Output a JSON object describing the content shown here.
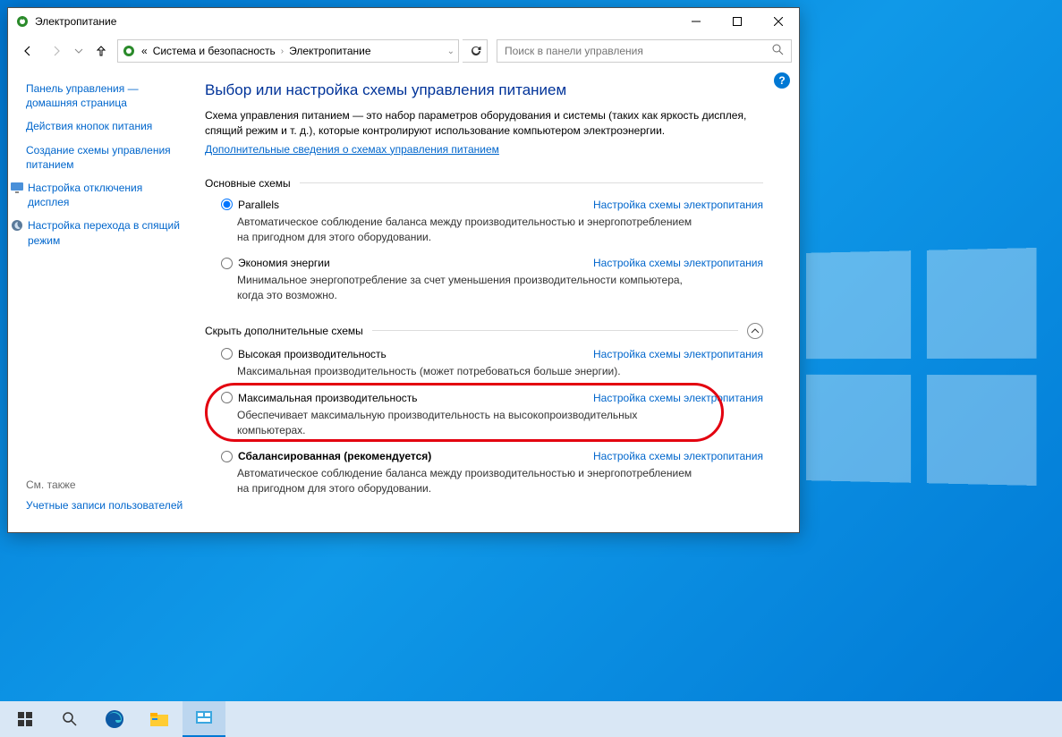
{
  "window": {
    "title": "Электропитание",
    "breadcrumb_prefix": "«",
    "breadcrumb1": "Система и безопасность",
    "breadcrumb2": "Электропитание",
    "search_placeholder": "Поиск в панели управления"
  },
  "sidebar": {
    "home": "Панель управления — домашняя страница",
    "links": [
      "Действия кнопок питания",
      "Создание схемы управления питанием",
      "Настройка отключения дисплея",
      "Настройка перехода в спящий режим"
    ],
    "see_also_h": "См. также",
    "see_also": "Учетные записи пользователей"
  },
  "main": {
    "heading": "Выбор или настройка схемы управления питанием",
    "desc": "Схема управления питанием — это набор параметров оборудования и системы (таких как яркость дисплея, спящий режим и т. д.), которые контролируют использование компьютером электроэнергии.",
    "more_link": "Дополнительные сведения о схемах управления питанием",
    "section1": "Основные схемы",
    "section2": "Скрыть дополнительные схемы",
    "change_link": "Настройка схемы электропитания",
    "plans": [
      {
        "name": "Parallels",
        "desc": "Автоматическое соблюдение баланса между производительностью и энергопотреблением на пригодном для этого оборудовании.",
        "checked": true
      },
      {
        "name": "Экономия энергии",
        "desc": "Минимальное энергопотребление за счет уменьшения производительности компьютера, когда это возможно.",
        "checked": false
      }
    ],
    "extra_plans": [
      {
        "name": "Высокая производительность",
        "desc": "Максимальная производительность (может потребоваться больше энергии).",
        "checked": false,
        "bold": false
      },
      {
        "name": "Максимальная производительность",
        "desc": "Обеспечивает максимальную производительность на высокопроизводительных компьютерах.",
        "checked": false,
        "bold": false,
        "highlight": true
      },
      {
        "name": "Сбалансированная (рекомендуется)",
        "desc": "Автоматическое соблюдение баланса между производительностью и энергопотреблением на пригодном для этого оборудовании.",
        "checked": false,
        "bold": true
      }
    ]
  }
}
